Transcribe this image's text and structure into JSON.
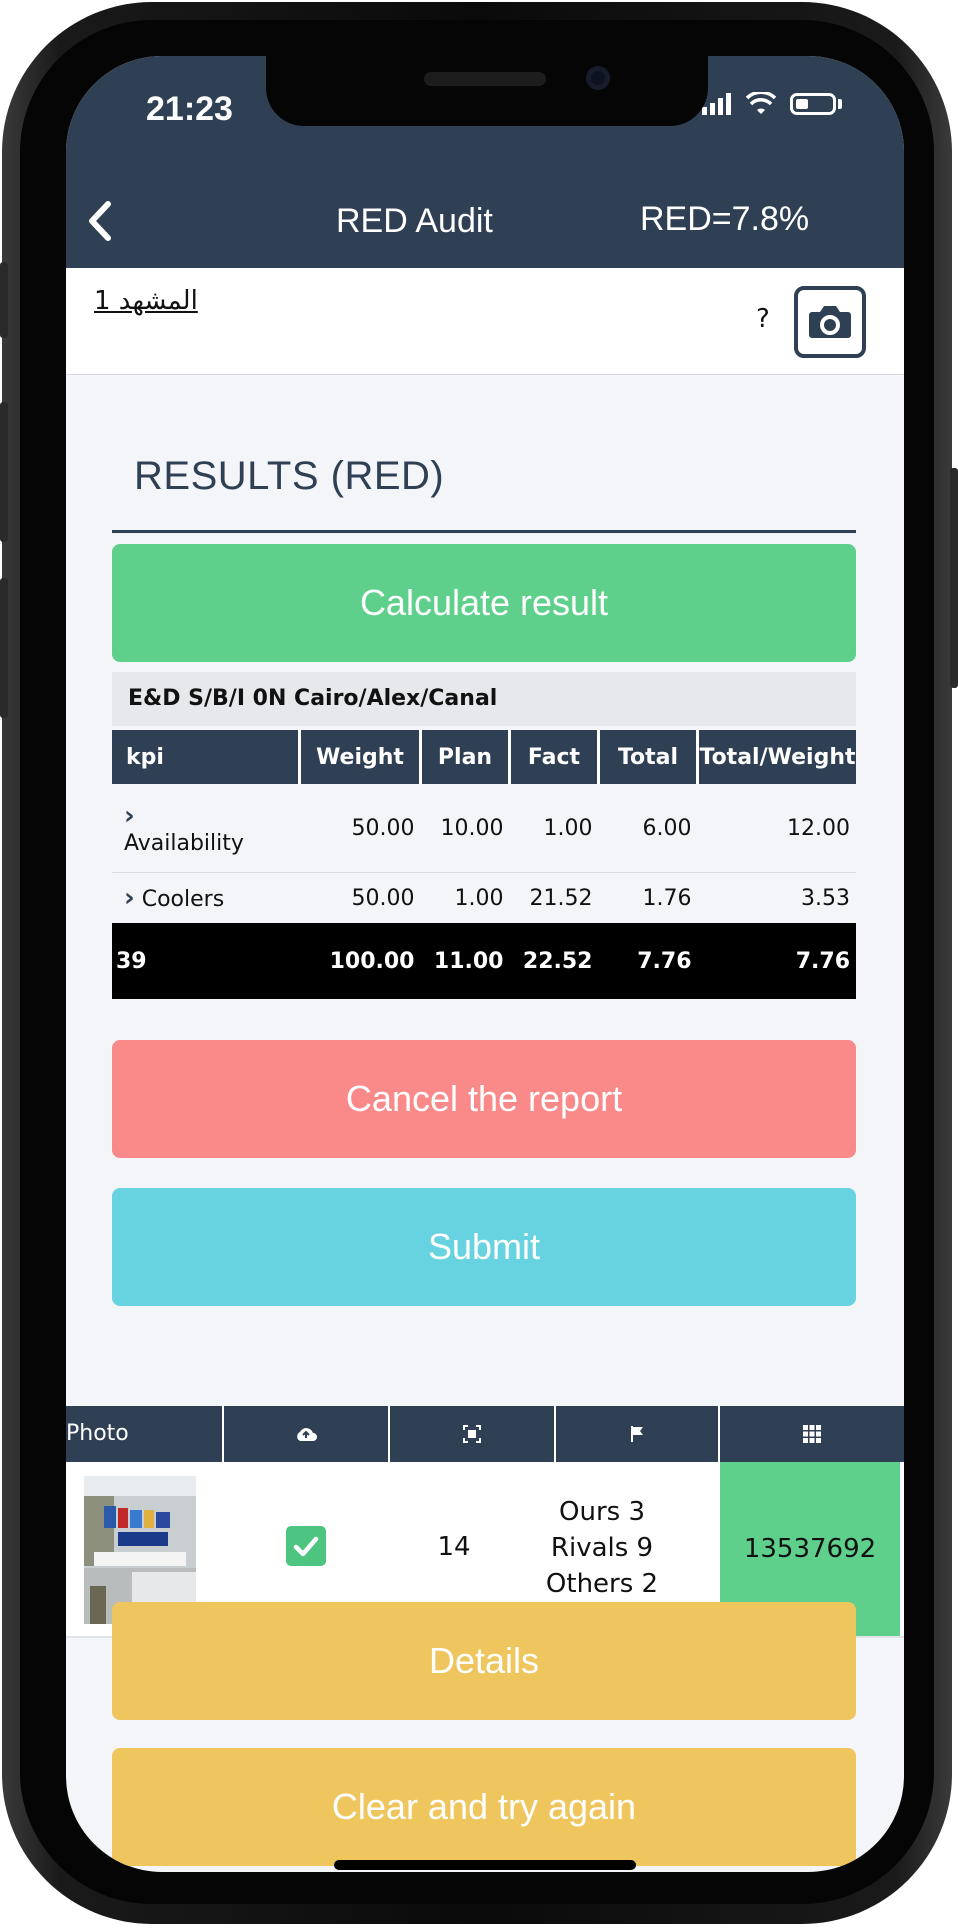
{
  "status": {
    "time": "21:23"
  },
  "nav": {
    "title": "RED Audit",
    "red_value": "RED=7.8%"
  },
  "scene": {
    "link_label": "المشهد 1",
    "help": "?"
  },
  "results": {
    "title": "RESULTS (RED)"
  },
  "buttons": {
    "calculate": "Calculate result",
    "cancel": "Cancel the report",
    "submit": "Submit",
    "details": "Details",
    "clear": "Clear and try again"
  },
  "kpi_table": {
    "region": "E&D S/B/I 0N Cairo/Alex/Canal",
    "headers": [
      "kpi",
      "Weight",
      "Plan",
      "Fact",
      "Total",
      "Total/Weight"
    ],
    "rows": [
      {
        "name": "Availability",
        "weight": "50.00",
        "plan": "10.00",
        "fact": "1.00",
        "total": "6.00",
        "tw": "12.00"
      },
      {
        "name": "Coolers",
        "weight": "50.00",
        "plan": "1.00",
        "fact": "21.52",
        "total": "1.76",
        "tw": "3.53"
      }
    ],
    "total_row": {
      "name": "39",
      "weight": "100.00",
      "plan": "11.00",
      "fact": "22.52",
      "total": "7.76",
      "tw": "7.76"
    }
  },
  "photo_table": {
    "headers": {
      "photo": "Photo",
      "icons": [
        "cloud-upload-icon",
        "scan-frame-icon",
        "flag-icon",
        "grid-icon"
      ]
    },
    "row": {
      "count": "14",
      "ours": "Ours 3",
      "rivals": "Rivals 9",
      "others": "Others 2",
      "id": "13537692"
    }
  },
  "colors": {
    "header": "#2f4054",
    "green": "#5ed08c",
    "red": "#fa8a8a",
    "cyan": "#68d3e0",
    "yellow": "#efc65e"
  }
}
